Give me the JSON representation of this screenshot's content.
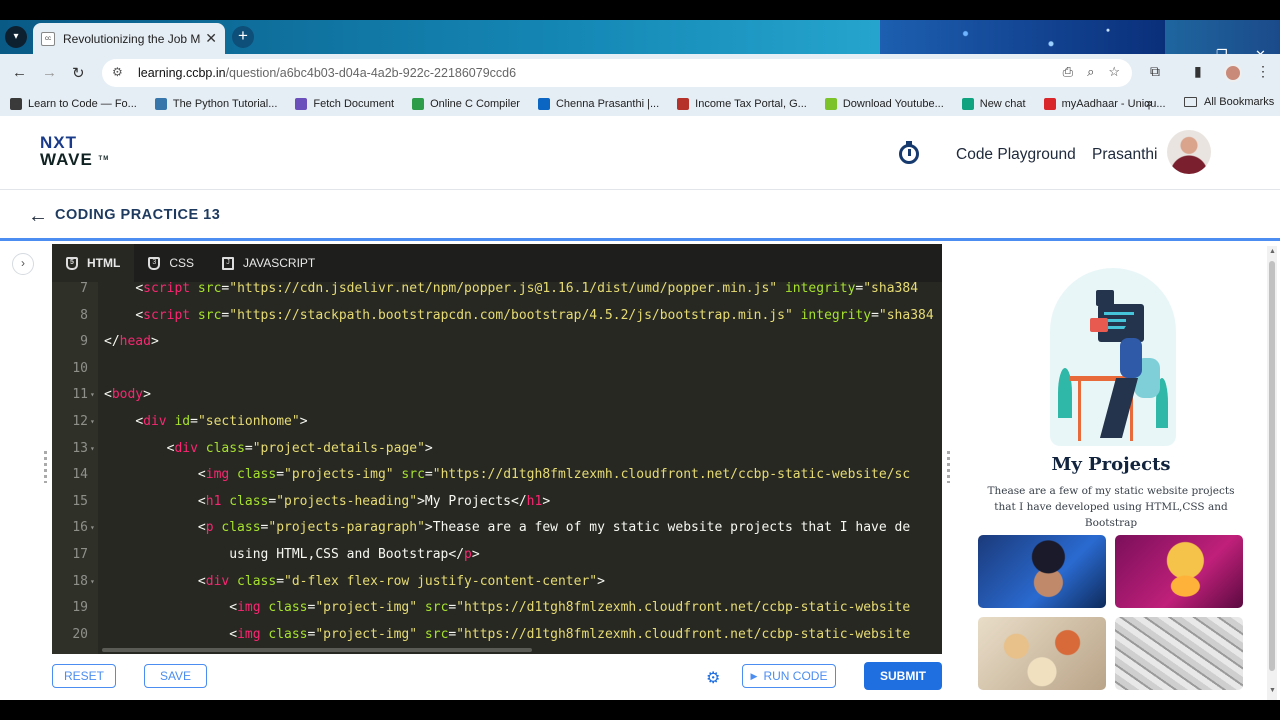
{
  "browser": {
    "tab_title": "Revolutionizing the Job Market",
    "url_host": "learning.ccbp.in",
    "url_path": "/question/a6bc4b03-d04a-4a2b-922c-22186079ccd6",
    "bookmarks": [
      {
        "label": "Learn to Code — Fo...",
        "color": "#3a3a3a"
      },
      {
        "label": "The Python Tutorial...",
        "color": "#3776ab"
      },
      {
        "label": "Fetch Document",
        "color": "#6b4fbb"
      },
      {
        "label": "Online C Compiler",
        "color": "#2e9d4a"
      },
      {
        "label": "Chenna Prasanthi |...",
        "color": "#0a66c2"
      },
      {
        "label": "Income Tax Portal, G...",
        "color": "#b5322a"
      },
      {
        "label": "Download Youtube...",
        "color": "#7cc32a"
      },
      {
        "label": "New chat",
        "color": "#10a37f"
      },
      {
        "label": "myAadhaar - Uniqu...",
        "color": "#d9262b"
      }
    ],
    "all_bookmarks": "All Bookmarks"
  },
  "header": {
    "logo_top": "NXT",
    "logo_bottom": "WAVE",
    "logo_tm": "TM",
    "code_playground": "Code Playground",
    "username": "Prasanthi"
  },
  "page": {
    "title": "CODING PRACTICE 13"
  },
  "editor": {
    "tabs": [
      "HTML",
      "CSS",
      "JAVASCRIPT"
    ],
    "lines": [
      {
        "n": "7",
        "fold": "",
        "indent": "    ",
        "parts": [
          [
            "p",
            "<"
          ],
          [
            "t",
            "script"
          ],
          [
            "a",
            " src"
          ],
          [
            "p",
            "="
          ],
          [
            "s",
            "\"https://cdn.jsdelivr.net/npm/popper.js@1.16.1/dist/umd/popper.min.js\""
          ],
          [
            "a",
            " integrity"
          ],
          [
            "p",
            "="
          ],
          [
            "s",
            "\"sha384"
          ]
        ]
      },
      {
        "n": "8",
        "fold": "",
        "indent": "    ",
        "parts": [
          [
            "p",
            "<"
          ],
          [
            "t",
            "script"
          ],
          [
            "a",
            " src"
          ],
          [
            "p",
            "="
          ],
          [
            "s",
            "\"https://stackpath.bootstrapcdn.com/bootstrap/4.5.2/js/bootstrap.min.js\""
          ],
          [
            "a",
            " integrity"
          ],
          [
            "p",
            "="
          ],
          [
            "s",
            "\"sha384"
          ]
        ]
      },
      {
        "n": "9",
        "fold": "",
        "indent": "",
        "parts": [
          [
            "p",
            "</"
          ],
          [
            "t",
            "head"
          ],
          [
            "p",
            ">"
          ]
        ]
      },
      {
        "n": "10",
        "fold": "",
        "indent": "",
        "parts": []
      },
      {
        "n": "11",
        "fold": "▾",
        "indent": "",
        "parts": [
          [
            "p",
            "<"
          ],
          [
            "t",
            "body"
          ],
          [
            "p",
            ">"
          ]
        ]
      },
      {
        "n": "12",
        "fold": "▾",
        "indent": "    ",
        "parts": [
          [
            "p",
            "<"
          ],
          [
            "t",
            "div"
          ],
          [
            "a",
            " id"
          ],
          [
            "p",
            "="
          ],
          [
            "s",
            "\"sectionhome\""
          ],
          [
            "p",
            ">"
          ]
        ]
      },
      {
        "n": "13",
        "fold": "▾",
        "indent": "        ",
        "parts": [
          [
            "p",
            "<"
          ],
          [
            "t",
            "div"
          ],
          [
            "a",
            " class"
          ],
          [
            "p",
            "="
          ],
          [
            "s",
            "\"project-details-page\""
          ],
          [
            "p",
            ">"
          ]
        ]
      },
      {
        "n": "14",
        "fold": "",
        "indent": "            ",
        "parts": [
          [
            "p",
            "<"
          ],
          [
            "t",
            "img"
          ],
          [
            "a",
            " class"
          ],
          [
            "p",
            "="
          ],
          [
            "s",
            "\"projects-img\""
          ],
          [
            "a",
            " src"
          ],
          [
            "p",
            "="
          ],
          [
            "s",
            "\"https://d1tgh8fmlzexmh.cloudfront.net/ccbp-static-website/sc"
          ]
        ]
      },
      {
        "n": "15",
        "fold": "",
        "indent": "            ",
        "parts": [
          [
            "p",
            "<"
          ],
          [
            "t",
            "h1"
          ],
          [
            "a",
            " class"
          ],
          [
            "p",
            "="
          ],
          [
            "s",
            "\"projects-heading\""
          ],
          [
            "p",
            ">My Projects</"
          ],
          [
            "t",
            "h1"
          ],
          [
            "p",
            ">"
          ]
        ]
      },
      {
        "n": "16",
        "fold": "▾",
        "indent": "            ",
        "parts": [
          [
            "p",
            "<"
          ],
          [
            "t",
            "p"
          ],
          [
            "a",
            " class"
          ],
          [
            "p",
            "="
          ],
          [
            "s",
            "\"projects-paragraph\""
          ],
          [
            "p",
            ">Thease are a few of my static website projects that I have de"
          ]
        ]
      },
      {
        "n": "17",
        "fold": "",
        "indent": "                ",
        "parts": [
          [
            "p",
            "using HTML,CSS and Bootstrap</"
          ],
          [
            "t",
            "p"
          ],
          [
            "p",
            ">"
          ]
        ]
      },
      {
        "n": "18",
        "fold": "▾",
        "indent": "            ",
        "parts": [
          [
            "p",
            "<"
          ],
          [
            "t",
            "div"
          ],
          [
            "a",
            " class"
          ],
          [
            "p",
            "="
          ],
          [
            "s",
            "\"d-flex flex-row justify-content-center\""
          ],
          [
            "p",
            ">"
          ]
        ]
      },
      {
        "n": "19",
        "fold": "",
        "indent": "                ",
        "parts": [
          [
            "p",
            "<"
          ],
          [
            "t",
            "img"
          ],
          [
            "a",
            " class"
          ],
          [
            "p",
            "="
          ],
          [
            "s",
            "\"project-img\""
          ],
          [
            "a",
            " src"
          ],
          [
            "p",
            "="
          ],
          [
            "s",
            "\"https://d1tgh8fmlzexmh.cloudfront.net/ccbp-static-website"
          ]
        ]
      },
      {
        "n": "20",
        "fold": "",
        "indent": "                ",
        "parts": [
          [
            "p",
            "<"
          ],
          [
            "t",
            "img"
          ],
          [
            "a",
            " class"
          ],
          [
            "p",
            "="
          ],
          [
            "s",
            "\"project-img\""
          ],
          [
            "a",
            " src"
          ],
          [
            "p",
            "="
          ],
          [
            "s",
            "\"https://d1tgh8fmlzexmh.cloudfront.net/ccbp-static-website"
          ]
        ]
      }
    ]
  },
  "footer": {
    "reset": "RESET",
    "save": "SAVE",
    "run_code": "RUN CODE",
    "submit": "SUBMIT"
  },
  "preview": {
    "title": "My Projects",
    "paragraph": "Thease are a few of my static website projects that I have developed using HTML,CSS and Bootstrap"
  },
  "colors": {
    "accent": "#1f6fe0",
    "editor_bg": "#272822",
    "tag": "#f92672",
    "attr": "#a6e22e",
    "string": "#e6db74"
  }
}
